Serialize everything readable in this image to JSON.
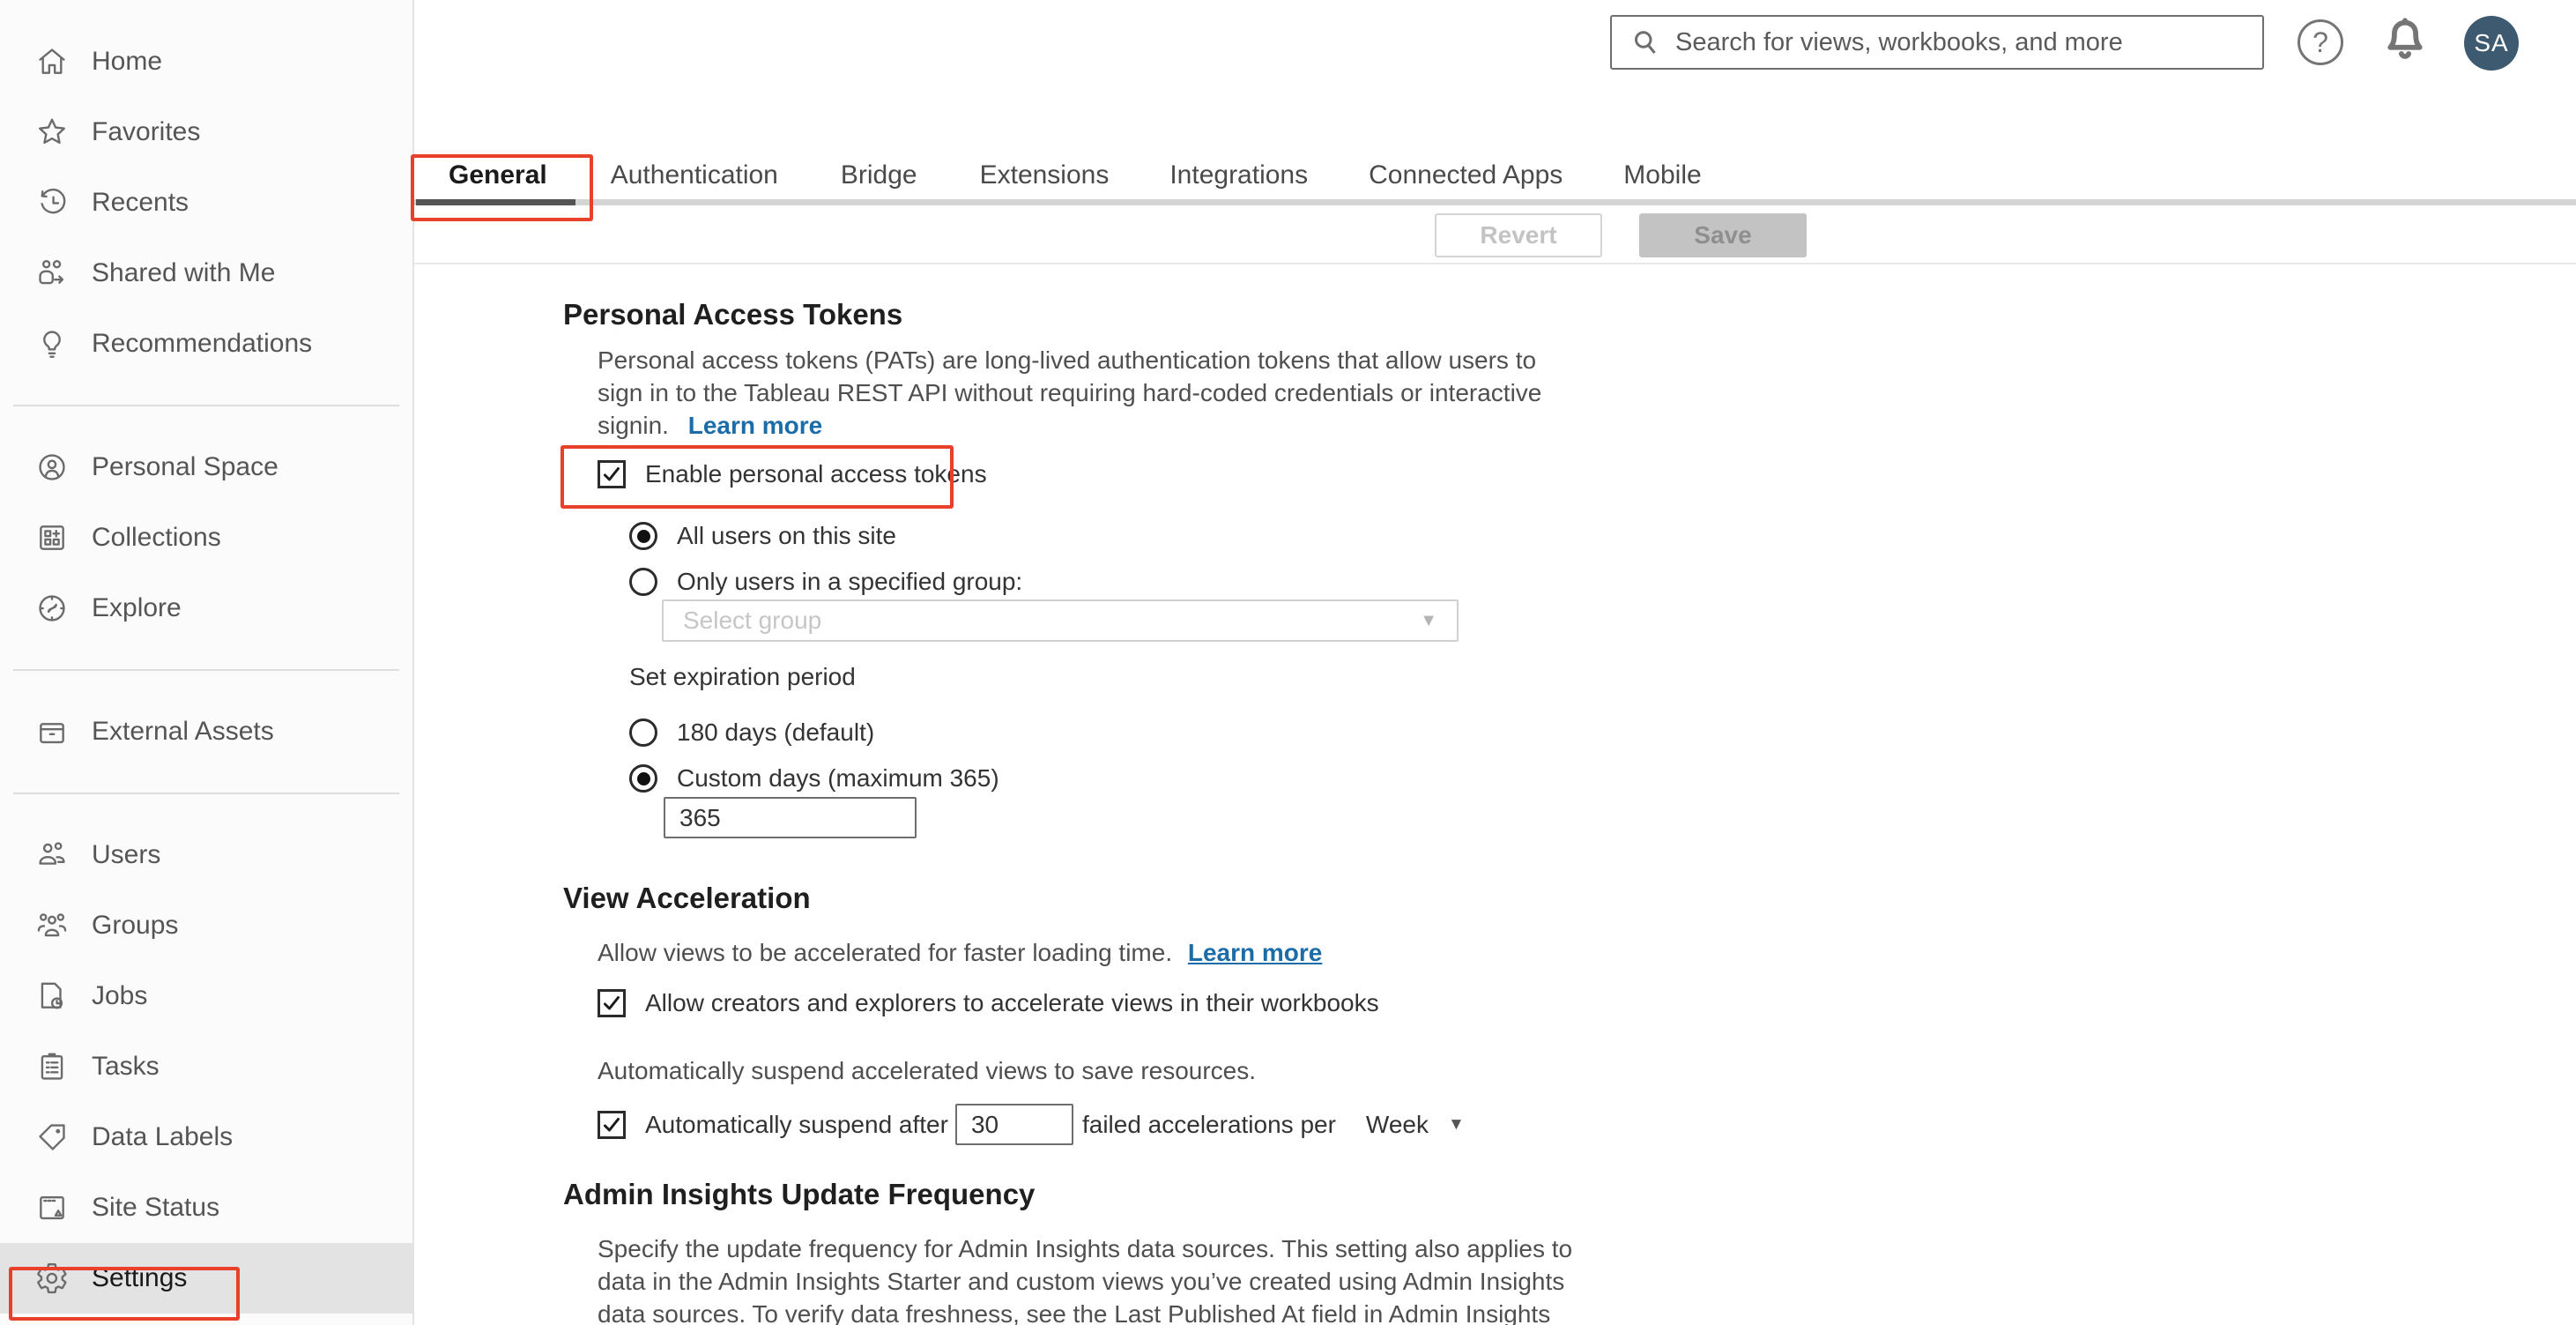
{
  "header": {
    "search_placeholder": "Search for views, workbooks, and more",
    "help_label": "?",
    "avatar_initials": "SA"
  },
  "sidebar": {
    "groups": [
      {
        "items": [
          {
            "label": "Home",
            "icon": "home-icon"
          },
          {
            "label": "Favorites",
            "icon": "star-icon"
          },
          {
            "label": "Recents",
            "icon": "recents-icon"
          },
          {
            "label": "Shared with Me",
            "icon": "shared-with-me-icon"
          },
          {
            "label": "Recommendations",
            "icon": "lightbulb-icon"
          }
        ]
      },
      {
        "items": [
          {
            "label": "Personal Space",
            "icon": "person-circle-icon"
          },
          {
            "label": "Collections",
            "icon": "collections-icon"
          },
          {
            "label": "Explore",
            "icon": "compass-icon"
          }
        ]
      },
      {
        "items": [
          {
            "label": "External Assets",
            "icon": "archive-box-icon"
          }
        ]
      },
      {
        "items": [
          {
            "label": "Users",
            "icon": "users-icon"
          },
          {
            "label": "Groups",
            "icon": "groups-icon"
          },
          {
            "label": "Jobs",
            "icon": "jobs-icon"
          },
          {
            "label": "Tasks",
            "icon": "tasks-icon"
          },
          {
            "label": "Data Labels",
            "icon": "tag-icon"
          },
          {
            "label": "Site Status",
            "icon": "site-status-icon"
          },
          {
            "label": "Settings",
            "icon": "gear-icon",
            "selected": true
          }
        ]
      }
    ]
  },
  "tabs": {
    "items": [
      {
        "label": "General",
        "selected": true
      },
      {
        "label": "Authentication"
      },
      {
        "label": "Bridge"
      },
      {
        "label": "Extensions"
      },
      {
        "label": "Integrations"
      },
      {
        "label": "Connected Apps"
      },
      {
        "label": "Mobile"
      }
    ]
  },
  "toolbar": {
    "revert_label": "Revert",
    "save_label": "Save"
  },
  "sections": {
    "pat": {
      "title": "Personal Access Tokens",
      "description_lines": [
        "Personal access tokens (PATs) are long-lived authentication tokens that allow users to",
        "sign in to the Tableau REST API without requiring hard-coded credentials or interactive"
      ],
      "description_last_line": "signin.",
      "learn_more": "Learn more",
      "enable_checkbox_label": "Enable personal access tokens",
      "radio_all_users_label": "All users on this site",
      "radio_group_label": "Only users in a specified group:",
      "group_select_placeholder": "Select group",
      "expiration_label": "Set expiration period",
      "radio_default_label": "180 days (default)",
      "radio_custom_label": "Custom days (maximum 365)",
      "custom_days_value": "365"
    },
    "view_acceleration": {
      "title": "View Acceleration",
      "description": "Allow views to be accelerated for faster loading time.",
      "learn_more": "Learn more",
      "allow_checkbox_label": "Allow creators and explorers to accelerate views in their workbooks",
      "suspend_note": "Automatically suspend accelerated views to save resources.",
      "suspend_checkbox_prefix": "Automatically suspend after",
      "suspend_threshold_value": "30",
      "suspend_suffix": "failed accelerations per",
      "suspend_period_value": "Week"
    },
    "admin_insights": {
      "title": "Admin Insights Update Frequency",
      "description_lines": [
        "Specify the update frequency for Admin Insights data sources. This setting also applies to",
        "data in the Admin Insights Starter and custom views you’ve created using Admin Insights",
        "data sources. To verify data freshness, see the Last Published At field in Admin Insights"
      ]
    }
  },
  "colors": {
    "annotation_red": "#e8402a",
    "link_blue": "#1c6ca8",
    "avatar_bg": "#3d5a70",
    "tab_underline": "#545454",
    "sidebar_selected_bg": "#e3e3e3"
  }
}
